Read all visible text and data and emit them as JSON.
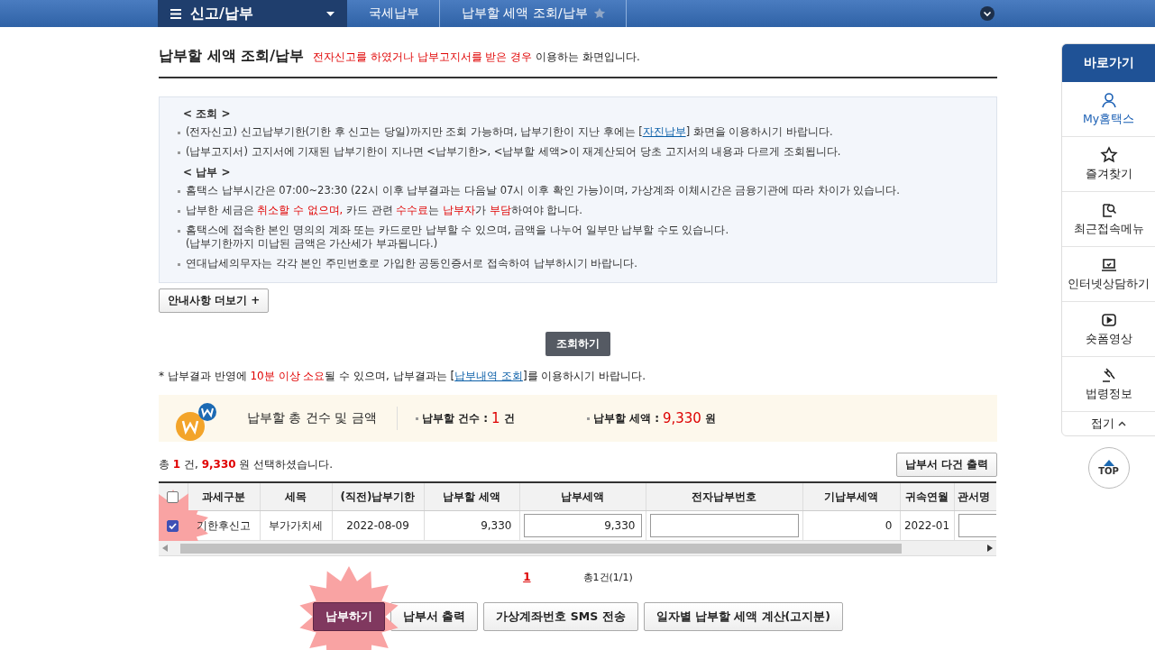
{
  "nav": {
    "section": "신고/납부",
    "breadcrumbs": [
      "국세납부",
      "납부할 세액 조회/납부"
    ]
  },
  "page_title": "납부할 세액 조회/납부",
  "subtitle": [
    {
      "text": "전자신고를 하였거나 납부고지서를 받은 경우",
      "kind": "red"
    },
    {
      "text": " 이용하는 화면입니다.",
      "kind": "plain"
    }
  ],
  "info": [
    {
      "heading": "< 조회 >",
      "items": [
        {
          "parts": [
            {
              "text": "(전자신고) 신고납부기한(기한 후 신고는 당일)까지만 조회 가능하며, 납부기한이 지난 후에는 [",
              "kind": "plain"
            },
            {
              "text": "자진납부",
              "kind": "link"
            },
            {
              "text": "] 화면을 이용하시기 바랍니다.",
              "kind": "plain"
            }
          ]
        },
        {
          "parts": [
            {
              "text": "(납부고지서) 고지서에 기재된 납부기한이 지나면 <납부기한>, <납부할 세액>이 재계산되어 당초 고지서의 내용과 다르게 조회됩니다.",
              "kind": "plain"
            }
          ]
        }
      ]
    },
    {
      "heading": "< 납부 >",
      "items": [
        {
          "parts": [
            {
              "text": "홈택스 납부시간은 07:00~23:30 (22시 이후 납부결과는 다음날 07시 이후 확인 가능)이며, 가상계좌 이체시간은 금융기관에 따라 차이가 있습니다.",
              "kind": "plain"
            }
          ]
        },
        {
          "parts": [
            {
              "text": "납부한 세금은 ",
              "kind": "plain"
            },
            {
              "text": "취소할 수 없으며,",
              "kind": "red"
            },
            {
              "text": " 카드 관련 ",
              "kind": "plain"
            },
            {
              "text": "수수료",
              "kind": "red"
            },
            {
              "text": "는 ",
              "kind": "plain"
            },
            {
              "text": "납부자",
              "kind": "red"
            },
            {
              "text": "가 ",
              "kind": "plain"
            },
            {
              "text": "부담",
              "kind": "red"
            },
            {
              "text": "하여야 합니다.",
              "kind": "plain"
            }
          ]
        },
        {
          "parts": [
            {
              "text": "홈택스에 접속한 본인 명의의 계좌 또는 카드로만 납부할 수 있으며, 금액을 나누어 일부만 납부할 수도 있습니다.",
              "kind": "plain"
            }
          ],
          "note": "(납부기한까지 미납된 금액은 가산세가 부과됩니다.)"
        },
        {
          "parts": [
            {
              "text": "연대납세의무자는 각각 본인 주민번호로 가입한 공동인증서로 접속하여 납부하시기 바랍니다.",
              "kind": "plain"
            }
          ]
        }
      ]
    }
  ],
  "more_button": "안내사항 더보기 +",
  "search_button": "조회하기",
  "notice": [
    {
      "text": "* 납부결과 반영에 ",
      "kind": "plain"
    },
    {
      "text": "10분 이상 소요",
      "kind": "red"
    },
    {
      "text": "될 수 있으며, 납부결과는 [",
      "kind": "plain"
    },
    {
      "text": "납부내역 조회",
      "kind": "link"
    },
    {
      "text": "]를 이용하시기 바랍니다.",
      "kind": "plain"
    }
  ],
  "summary": {
    "title": "납부할 총 건수 및 금액",
    "count_label": "납부할 건수 :",
    "count": "1",
    "count_unit": "건",
    "amount_label": "납부할 세액 :",
    "amount": "9,330",
    "amount_unit": "원"
  },
  "selection": [
    {
      "text": "총 ",
      "kind": "plain"
    },
    {
      "text": "1",
      "kind": "red"
    },
    {
      "text": " 건, ",
      "kind": "plain"
    },
    {
      "text": "9,330",
      "kind": "red"
    },
    {
      "text": " 원 선택하셨습니다.",
      "kind": "plain"
    }
  ],
  "print_multi_button": "납부서 다건 출력",
  "table": {
    "all_checked": false,
    "columns": [
      "과세구분",
      "세목",
      "(직전)납부기한",
      "납부할 세액",
      "납부세액",
      "전자납부번호",
      "기납부세액",
      "귀속연월",
      "관서명"
    ],
    "rows": [
      {
        "checked": true,
        "cells": [
          {
            "kind": "text",
            "text": "기한후신고"
          },
          {
            "kind": "text",
            "text": "부가가치세"
          },
          {
            "kind": "text",
            "text": "2022-08-09"
          },
          {
            "kind": "number",
            "text": "9,330"
          },
          {
            "kind": "input",
            "text": "9,330"
          },
          {
            "kind": "input"
          },
          {
            "kind": "number",
            "text": "0"
          },
          {
            "kind": "text",
            "text": "2022-01"
          },
          {
            "kind": "input"
          }
        ]
      }
    ]
  },
  "pagination": {
    "pages": [
      {
        "label": "1",
        "selected": true
      }
    ],
    "total": "총1건(1/1)"
  },
  "actions": [
    {
      "label": "납부하기",
      "kind": "primary"
    },
    {
      "label": "납부서 출력",
      "kind": "default"
    },
    {
      "label": "가상계좌번호 SMS 전송",
      "kind": "default"
    },
    {
      "label": "일자별 납부할 세액 계산(고지분)",
      "kind": "default"
    }
  ],
  "quick_menu": {
    "title": "바로가기",
    "items": [
      {
        "label": "My홈택스",
        "kind": "person",
        "selected": true
      },
      {
        "label": "즐겨찾기",
        "kind": "star",
        "selected": false
      },
      {
        "label": "최근접속메뉴",
        "kind": "search-doc",
        "selected": false
      },
      {
        "label": "인터넷상담하기",
        "kind": "laptop",
        "selected": false
      },
      {
        "label": "숏폼영상",
        "kind": "play",
        "selected": false
      },
      {
        "label": "법령정보",
        "kind": "gavel",
        "selected": false
      }
    ],
    "collapse": "접기",
    "top": "TOP"
  }
}
